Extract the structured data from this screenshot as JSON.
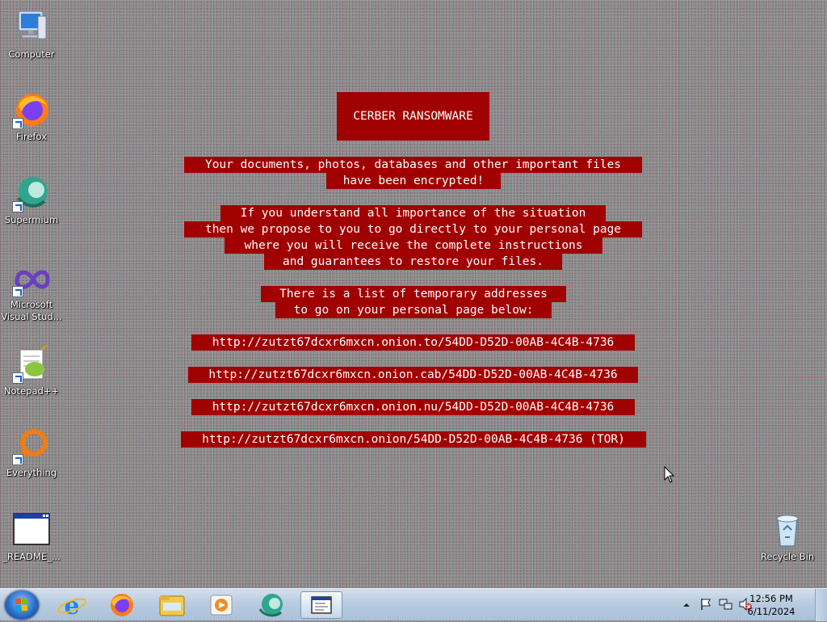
{
  "desktop_icons": [
    {
      "label": "Computer",
      "icon": "computer-icon"
    },
    {
      "label": "Firefox",
      "icon": "firefox-icon"
    },
    {
      "label": "Supermium",
      "icon": "supermium-icon"
    },
    {
      "label": "Microsoft Visual Stud...",
      "icon": "visual-studio-icon"
    },
    {
      "label": "Notepad++",
      "icon": "notepadpp-icon"
    },
    {
      "label": "Everything",
      "icon": "everything-icon"
    },
    {
      "label": "_README_...",
      "icon": "readme-window-icon"
    },
    {
      "label": "Recycle Bin",
      "icon": "recycle-bin-icon"
    }
  ],
  "ransom_note": {
    "title": "CERBER RANSOMWARE",
    "lines": [
      "Your documents, photos, databases and other important files",
      "have been encrypted!",
      "If you understand all importance of the situation",
      "then we propose to you to go directly to your personal page",
      "where you will receive the complete instructions",
      "and guarantees to restore your files.",
      "There is a list of temporary addresses",
      "to go on your personal page below:",
      "http://zutzt67dcxr6mxcn.onion.to/54DD-D52D-00AB-4C4B-4736",
      "http://zutzt67dcxr6mxcn.onion.cab/54DD-D52D-00AB-4C4B-4736",
      "http://zutzt67dcxr6mxcn.onion.nu/54DD-D52D-00AB-4C4B-4736",
      "http://zutzt67dcxr6mxcn.onion/54DD-D52D-00AB-4C4B-4736 (TOR)"
    ],
    "background_color": "#a10000"
  },
  "taskbar": {
    "start_icon": "windows-start-icon",
    "pinned": [
      "internet-explorer-icon",
      "firefox-icon",
      "file-explorer-icon",
      "media-player-icon",
      "supermium-icon",
      "readme-window-icon"
    ],
    "tray_icons": [
      "show-hidden-icons-chevron",
      "action-center-flag-icon",
      "network-icon",
      "volume-muted-icon"
    ],
    "clock": {
      "time": "12:56 PM",
      "date": "6/11/2024"
    }
  }
}
